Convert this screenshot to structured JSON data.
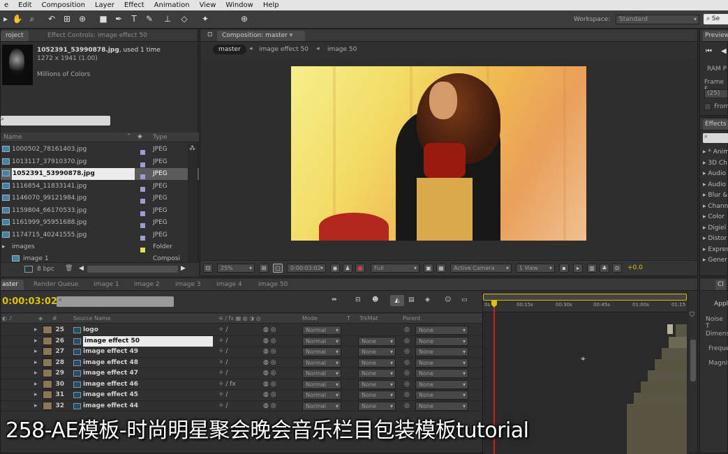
{
  "menubar": {
    "items": [
      "e",
      "Edit",
      "Composition",
      "Layer",
      "Effect",
      "Animation",
      "View",
      "Window",
      "Help"
    ]
  },
  "toolbar": {
    "workspace_label": "Workspace:",
    "workspace_value": "Standard",
    "search_value": "Se"
  },
  "project_panel": {
    "tabs": [
      "roject",
      "Effect Controls: image effect 50"
    ],
    "selected_file": "1052391_53990878.jpg",
    "used_text": ", used 1 time",
    "dimensions": "1272 x 1941 (1.00)",
    "colors": "Millions of Colors",
    "search_placeholder": "",
    "col_name": "Name",
    "col_type": "Type",
    "items": [
      {
        "name": "1000502_78161403.jpg",
        "type": "JPEG"
      },
      {
        "name": "1013117_37910370.jpg",
        "type": "JPEG"
      },
      {
        "name": "1052391_53990878.jpg",
        "type": "JPEG"
      },
      {
        "name": "1116854_11833141.jpg",
        "type": "JPEG"
      },
      {
        "name": "1146070_99121984.jpg",
        "type": "JPEG"
      },
      {
        "name": "1159804_66170533.jpg",
        "type": "JPEG"
      },
      {
        "name": "1161999_95951688.jpg",
        "type": "JPEG"
      },
      {
        "name": "1174715_40241555.jpg",
        "type": "JPEG"
      },
      {
        "name": "images",
        "type": "Folder"
      },
      {
        "name": "image 1",
        "type": "Composi"
      }
    ],
    "bpc": "8 bpc"
  },
  "composition_panel": {
    "tab": "Composition: master",
    "breadcrumbs": [
      "master",
      "image effect 50",
      "image 50"
    ],
    "zoom": "25%",
    "timecode": "0:00:03:02",
    "resolution": "Full",
    "camera": "Active Camera",
    "views": "1 View",
    "exposure": "+0.0"
  },
  "preview_panel": {
    "title": "Preview",
    "ram_preview": "RAM P",
    "frame_rate_label": "Frame F",
    "frame_rate_value": "(25)",
    "from_label": "From"
  },
  "effects_panel": {
    "title": "Effects",
    "items": [
      "* Anim",
      "3D Ch",
      "Audio",
      "Audio",
      "Blur &",
      "Chann",
      "Color",
      "Digiel",
      "Distor",
      "Expres",
      "Gener"
    ]
  },
  "side_panel2": {
    "labels": [
      "Appl",
      "Noise T",
      "Dimens",
      "Freque",
      "Magnit"
    ]
  },
  "timeline": {
    "tabs": [
      "aster",
      "Render Queue",
      "image 1",
      "image 2",
      "image 3",
      "image 4",
      "image 50"
    ],
    "current_time": "0:00:03:02",
    "ruler": [
      "0s",
      "00:15s",
      "00:30s",
      "00:45s",
      "01:00s",
      "01:15"
    ],
    "col_source": "Source Name",
    "col_mode": "Mode",
    "col_t": "T",
    "col_trkmat": "TrkMat",
    "col_parent": "Parent",
    "layers": [
      {
        "num": "25",
        "name": "logo",
        "mode": "Normal",
        "trkmat": "",
        "parent": "None"
      },
      {
        "num": "26",
        "name": "image effect 50",
        "mode": "Normal",
        "trkmat": "None",
        "parent": "None"
      },
      {
        "num": "27",
        "name": "image effect 49",
        "mode": "Normal",
        "trkmat": "None",
        "parent": "None"
      },
      {
        "num": "28",
        "name": "image effect 48",
        "mode": "Normal",
        "trkmat": "None",
        "parent": "None"
      },
      {
        "num": "29",
        "name": "image effect 47",
        "mode": "Normal",
        "trkmat": "None",
        "parent": "None"
      },
      {
        "num": "30",
        "name": "image effect 46",
        "mode": "Normal",
        "trkmat": "None",
        "parent": "None"
      },
      {
        "num": "31",
        "name": "image effect 45",
        "mode": "Normal",
        "trkmat": "None",
        "parent": "None"
      },
      {
        "num": "32",
        "name": "image effect 44",
        "mode": "Normal",
        "trkmat": "None",
        "parent": "None"
      }
    ]
  },
  "subtitle": "258-AE模板-时尚明星聚会晚会音乐栏目包装模板tutorial",
  "colors": {
    "accent_yellow": "#e0c000",
    "playhead_red": "#d02020",
    "panel_bg": "#303030"
  }
}
